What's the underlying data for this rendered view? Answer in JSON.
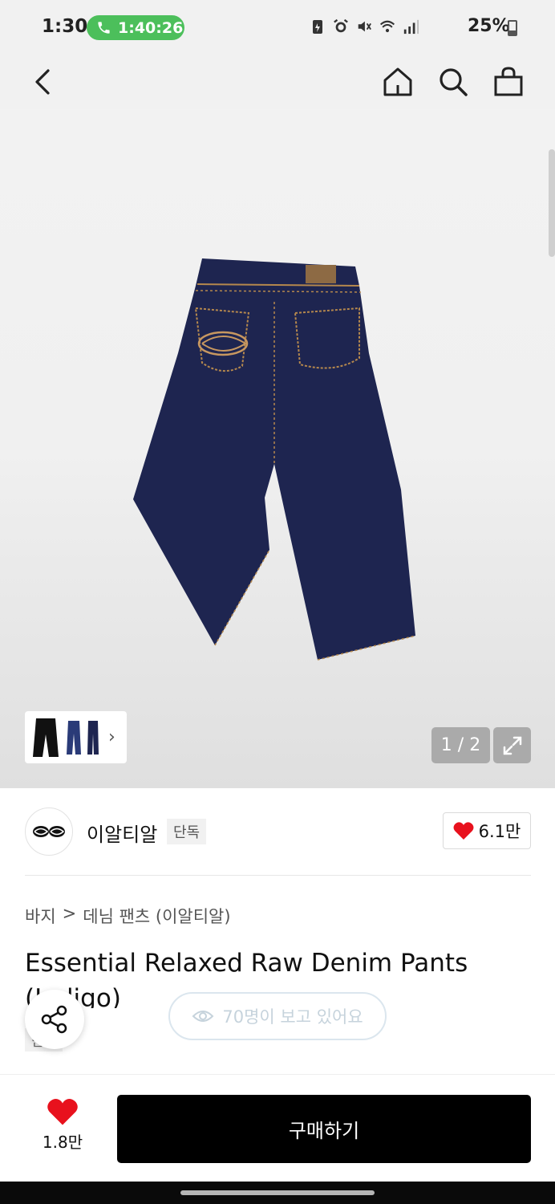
{
  "status_bar": {
    "time": "1:30",
    "call_duration": "1:40:26",
    "battery": "25%"
  },
  "nav": {
    "icons": [
      "back-icon",
      "home-icon",
      "search-icon",
      "shopping-bag-icon"
    ]
  },
  "gallery": {
    "counter": "1 / 2",
    "thumbnails_chevron": "›"
  },
  "brand": {
    "name": "이알티알",
    "exclusive_tag": "단독",
    "likes": "6.1만"
  },
  "product": {
    "breadcrumb": [
      "바지",
      "데님 팬츠 (이알티알)"
    ],
    "breadcrumb_sep": ">",
    "title": "Essential Relaxed Raw Denim Pants (Indigo)",
    "viewers": "70명이 보고 있어요",
    "sub_tag": "단독"
  },
  "bottom_bar": {
    "wish_count": "1.8만",
    "buy_label": "구매하기"
  },
  "colors": {
    "accent_green": "#4cbf5b",
    "heart_red": "#e8111d",
    "denim": "#1e2550",
    "buy_button": "#000000"
  }
}
